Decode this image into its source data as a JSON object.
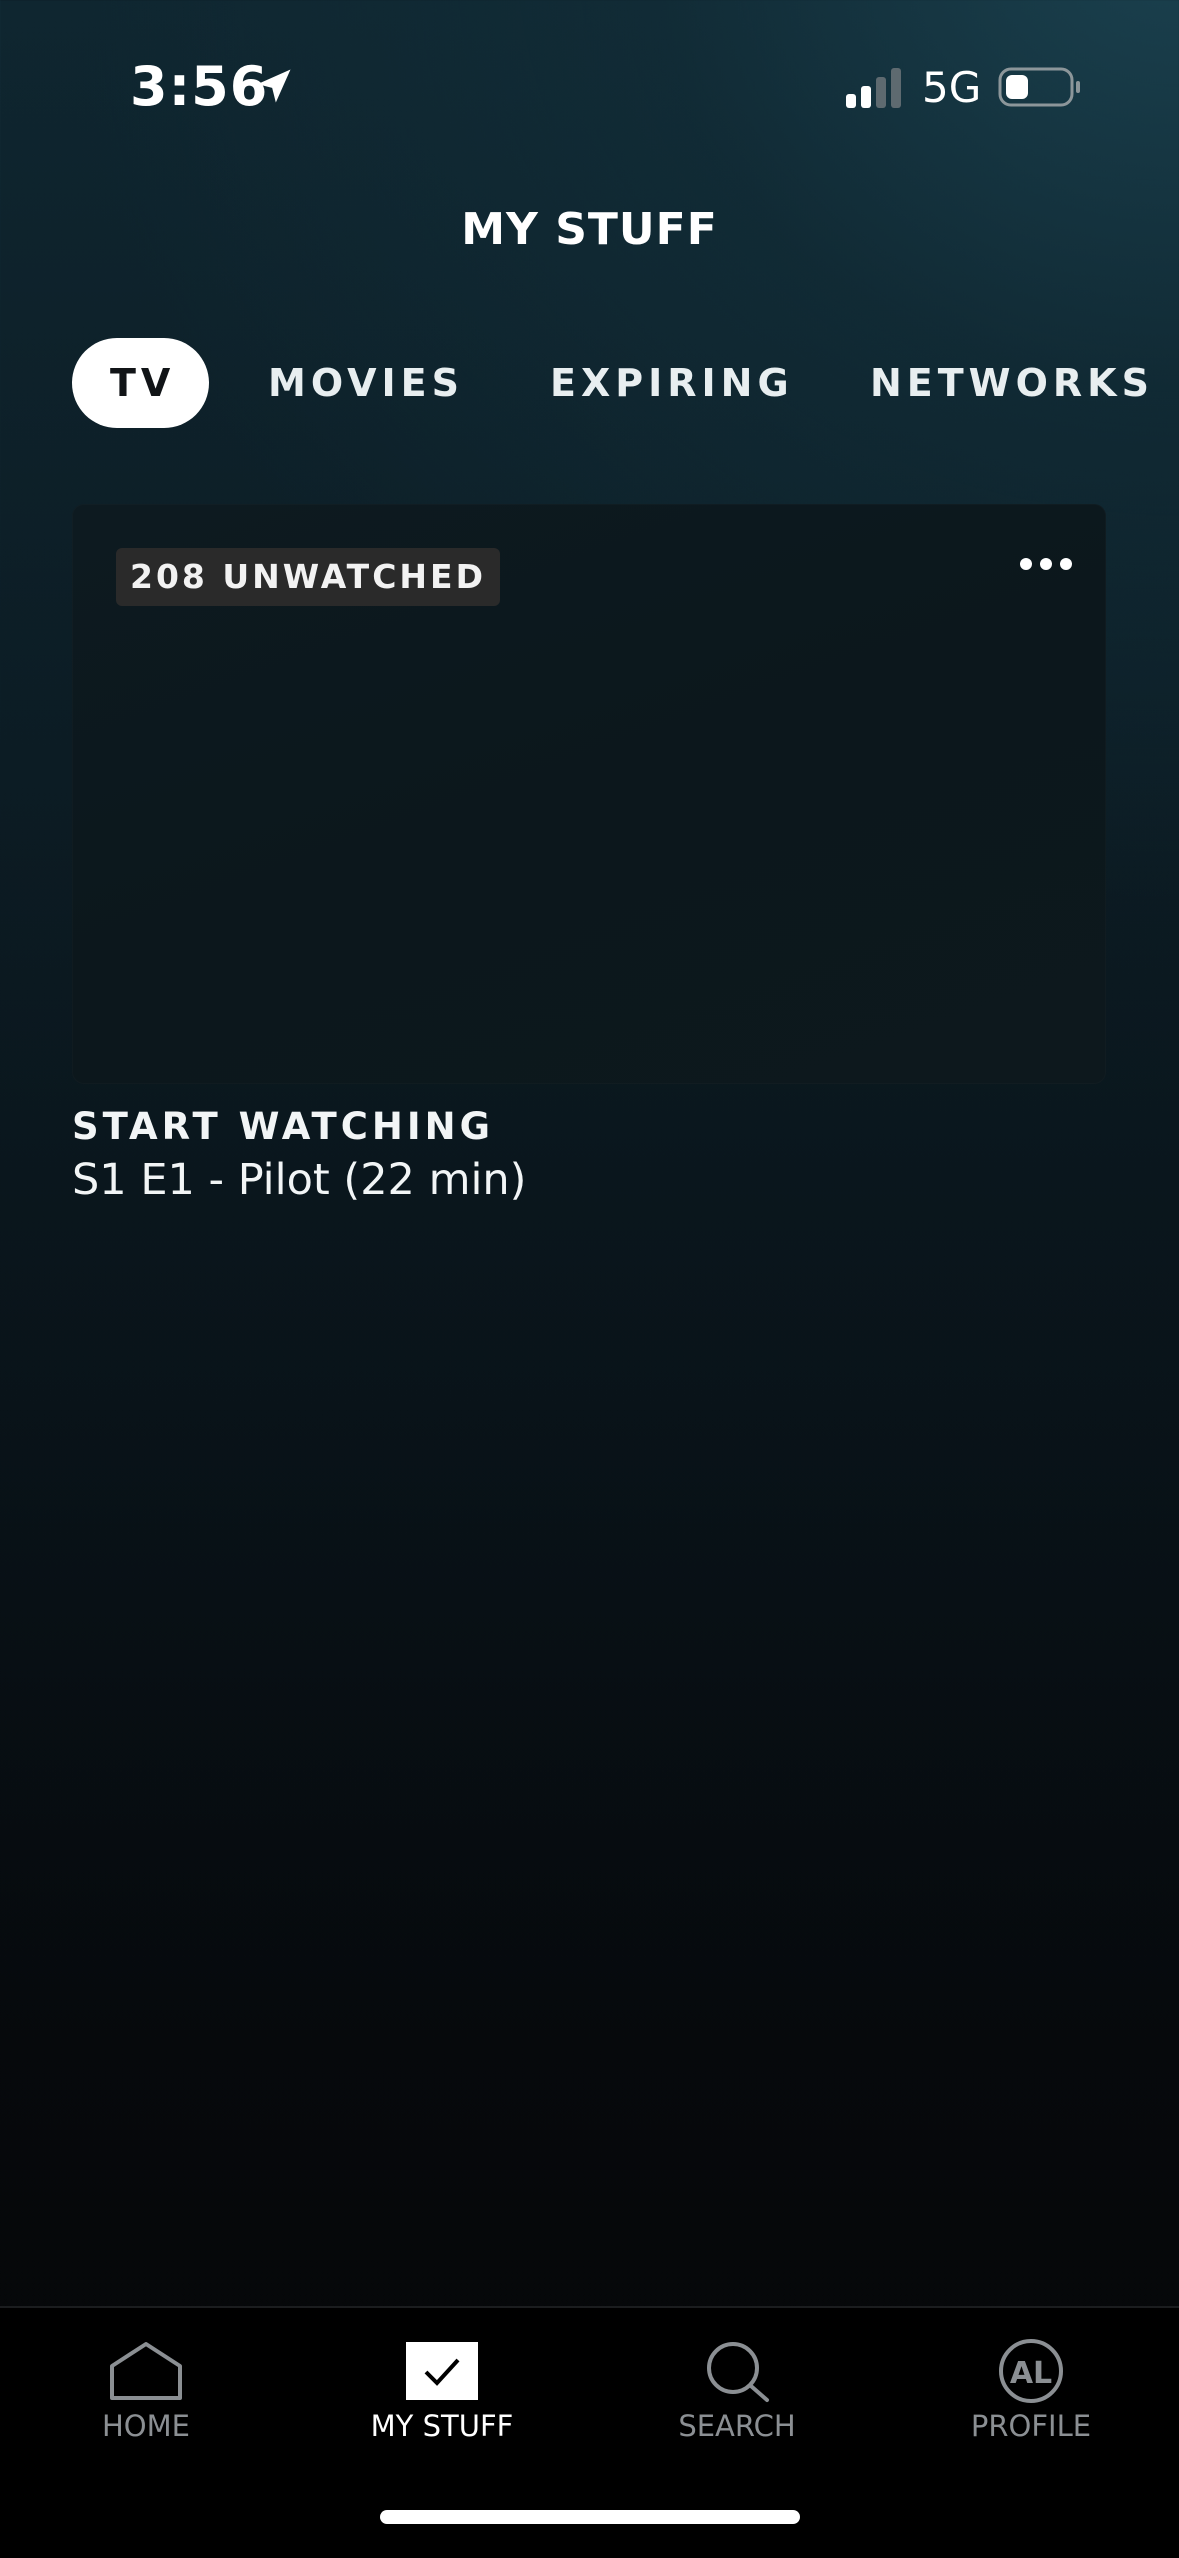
{
  "status_bar": {
    "time": "3:56",
    "network": "5G"
  },
  "header": {
    "title": "MY STUFF"
  },
  "tabs": [
    {
      "label": "TV",
      "active": true
    },
    {
      "label": "MOVIES",
      "active": false
    },
    {
      "label": "EXPIRING",
      "active": false
    },
    {
      "label": "NETWORKS",
      "active": false
    }
  ],
  "card": {
    "badge": "208 UNWATCHED",
    "status": "START WATCHING",
    "episode": "S1 E1 - Pilot (22 min)"
  },
  "bottom_nav": [
    {
      "label": "HOME",
      "icon": "home-icon",
      "active": false
    },
    {
      "label": "MY STUFF",
      "icon": "checkmark-icon",
      "active": true
    },
    {
      "label": "SEARCH",
      "icon": "search-icon",
      "active": false
    },
    {
      "label": "PROFILE",
      "icon": "avatar-icon",
      "avatar_initials": "AL",
      "active": false
    }
  ],
  "colors": {
    "active_tab_bg": "#ffffff",
    "inactive_nav_label": "#8b8f93",
    "nav_bg": "#000000",
    "badge_bg": "#2a2a2a"
  }
}
